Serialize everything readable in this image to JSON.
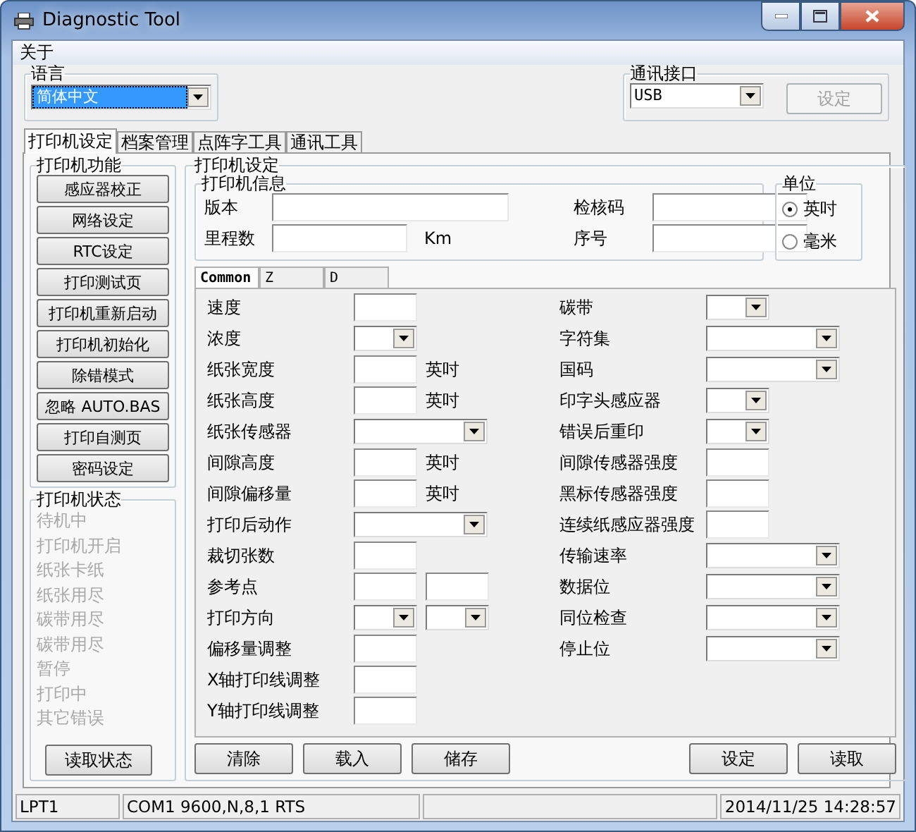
{
  "window": {
    "title": "Diagnostic Tool"
  },
  "menu": [
    "关于"
  ],
  "language": {
    "legend": "语言",
    "value": "简体中文",
    "highlighted": true
  },
  "port": {
    "legend": "通讯接口",
    "value": "USB",
    "button": {
      "label": "设定",
      "disabled": true
    }
  },
  "tabs": [
    {
      "label": "打印机设定",
      "selected": true
    },
    {
      "label": "档案管理",
      "selected": false
    },
    {
      "label": "点阵字工具",
      "selected": false
    },
    {
      "label": "通讯工具",
      "selected": false
    }
  ],
  "functions": {
    "legend": "打印机功能",
    "buttons": [
      "感应器校正",
      "网络设定",
      "RTC设定",
      "打印测试页",
      "打印机重新启动",
      "打印机初始化",
      "除错模式",
      "忽略 AUTO.BAS",
      "打印自测页",
      "密码设定"
    ]
  },
  "status": {
    "legend": "打印机状态",
    "items": [
      {
        "label": "待机中",
        "disabled": true
      },
      {
        "label": "打印机开启",
        "disabled": true
      },
      {
        "label": "纸张卡纸",
        "disabled": true
      },
      {
        "label": "纸张用尽",
        "disabled": true
      },
      {
        "label": "碳带用尽",
        "disabled": true
      },
      {
        "label": "碳带用尽",
        "disabled": true
      },
      {
        "label": "暂停",
        "disabled": true
      },
      {
        "label": "打印中",
        "disabled": true
      },
      {
        "label": "其它错误",
        "disabled": true
      }
    ],
    "button": "读取状态"
  },
  "settings": {
    "legend": "打印机设定",
    "info": {
      "legend": "打印机信息",
      "fields": [
        {
          "label": "版本",
          "kind": "long"
        },
        {
          "label": "检核码",
          "kind": "short"
        },
        {
          "label": "里程数",
          "kind": "unit",
          "unit": "Km"
        },
        {
          "label": "序号",
          "kind": "short"
        }
      ]
    },
    "unit": {
      "legend": "单位",
      "options": [
        {
          "label": "英吋",
          "selected": true
        },
        {
          "label": "毫米",
          "selected": false
        }
      ]
    },
    "inner_tabs": [
      {
        "label": "Common",
        "selected": true
      },
      {
        "label": "Z",
        "selected": false
      },
      {
        "label": "D",
        "selected": false
      }
    ],
    "left_rows": [
      {
        "label": "速度",
        "kind": "text"
      },
      {
        "label": "浓度",
        "kind": "combo"
      },
      {
        "label": "纸张宽度",
        "kind": "text",
        "unit": "英吋"
      },
      {
        "label": "纸张高度",
        "kind": "text",
        "unit": "英吋"
      },
      {
        "label": "纸张传感器",
        "kind": "wide_combo"
      },
      {
        "label": "间隙高度",
        "kind": "text",
        "unit": "英吋"
      },
      {
        "label": "间隙偏移量",
        "kind": "text",
        "unit": "英吋"
      },
      {
        "label": "打印后动作",
        "kind": "wide_combo"
      },
      {
        "label": "裁切张数",
        "kind": "text"
      },
      {
        "label": "参考点",
        "kind": "two_text"
      },
      {
        "label": "打印方向",
        "kind": "two_combo"
      },
      {
        "label": "偏移量调整",
        "kind": "text"
      },
      {
        "label": "X轴打印线调整",
        "kind": "text"
      },
      {
        "label": "Y轴打印线调整",
        "kind": "text"
      }
    ],
    "right_rows": [
      {
        "label": "碳带",
        "kind": "combo"
      },
      {
        "label": "字符集",
        "kind": "wide_combo"
      },
      {
        "label": "国码",
        "kind": "wide_combo"
      },
      {
        "label": "印字头感应器",
        "kind": "combo"
      },
      {
        "label": "错误后重印",
        "kind": "combo"
      },
      {
        "label": "间隙传感器强度",
        "kind": "text"
      },
      {
        "label": "黑标传感器强度",
        "kind": "text"
      },
      {
        "label": "连续纸感应器强度",
        "kind": "text"
      },
      {
        "label": "传输速率",
        "kind": "wide_combo"
      },
      {
        "label": "数据位",
        "kind": "wide_combo"
      },
      {
        "label": "同位检查",
        "kind": "wide_combo"
      },
      {
        "label": "停止位",
        "kind": "wide_combo"
      }
    ],
    "actions_left": [
      "清除",
      "载入",
      "储存"
    ],
    "actions_right": [
      "设定",
      "读取"
    ]
  },
  "status_bar": [
    "LPT1",
    "COM1 9600,N,8,1 RTS",
    "2014/11/25 14:28:57"
  ]
}
